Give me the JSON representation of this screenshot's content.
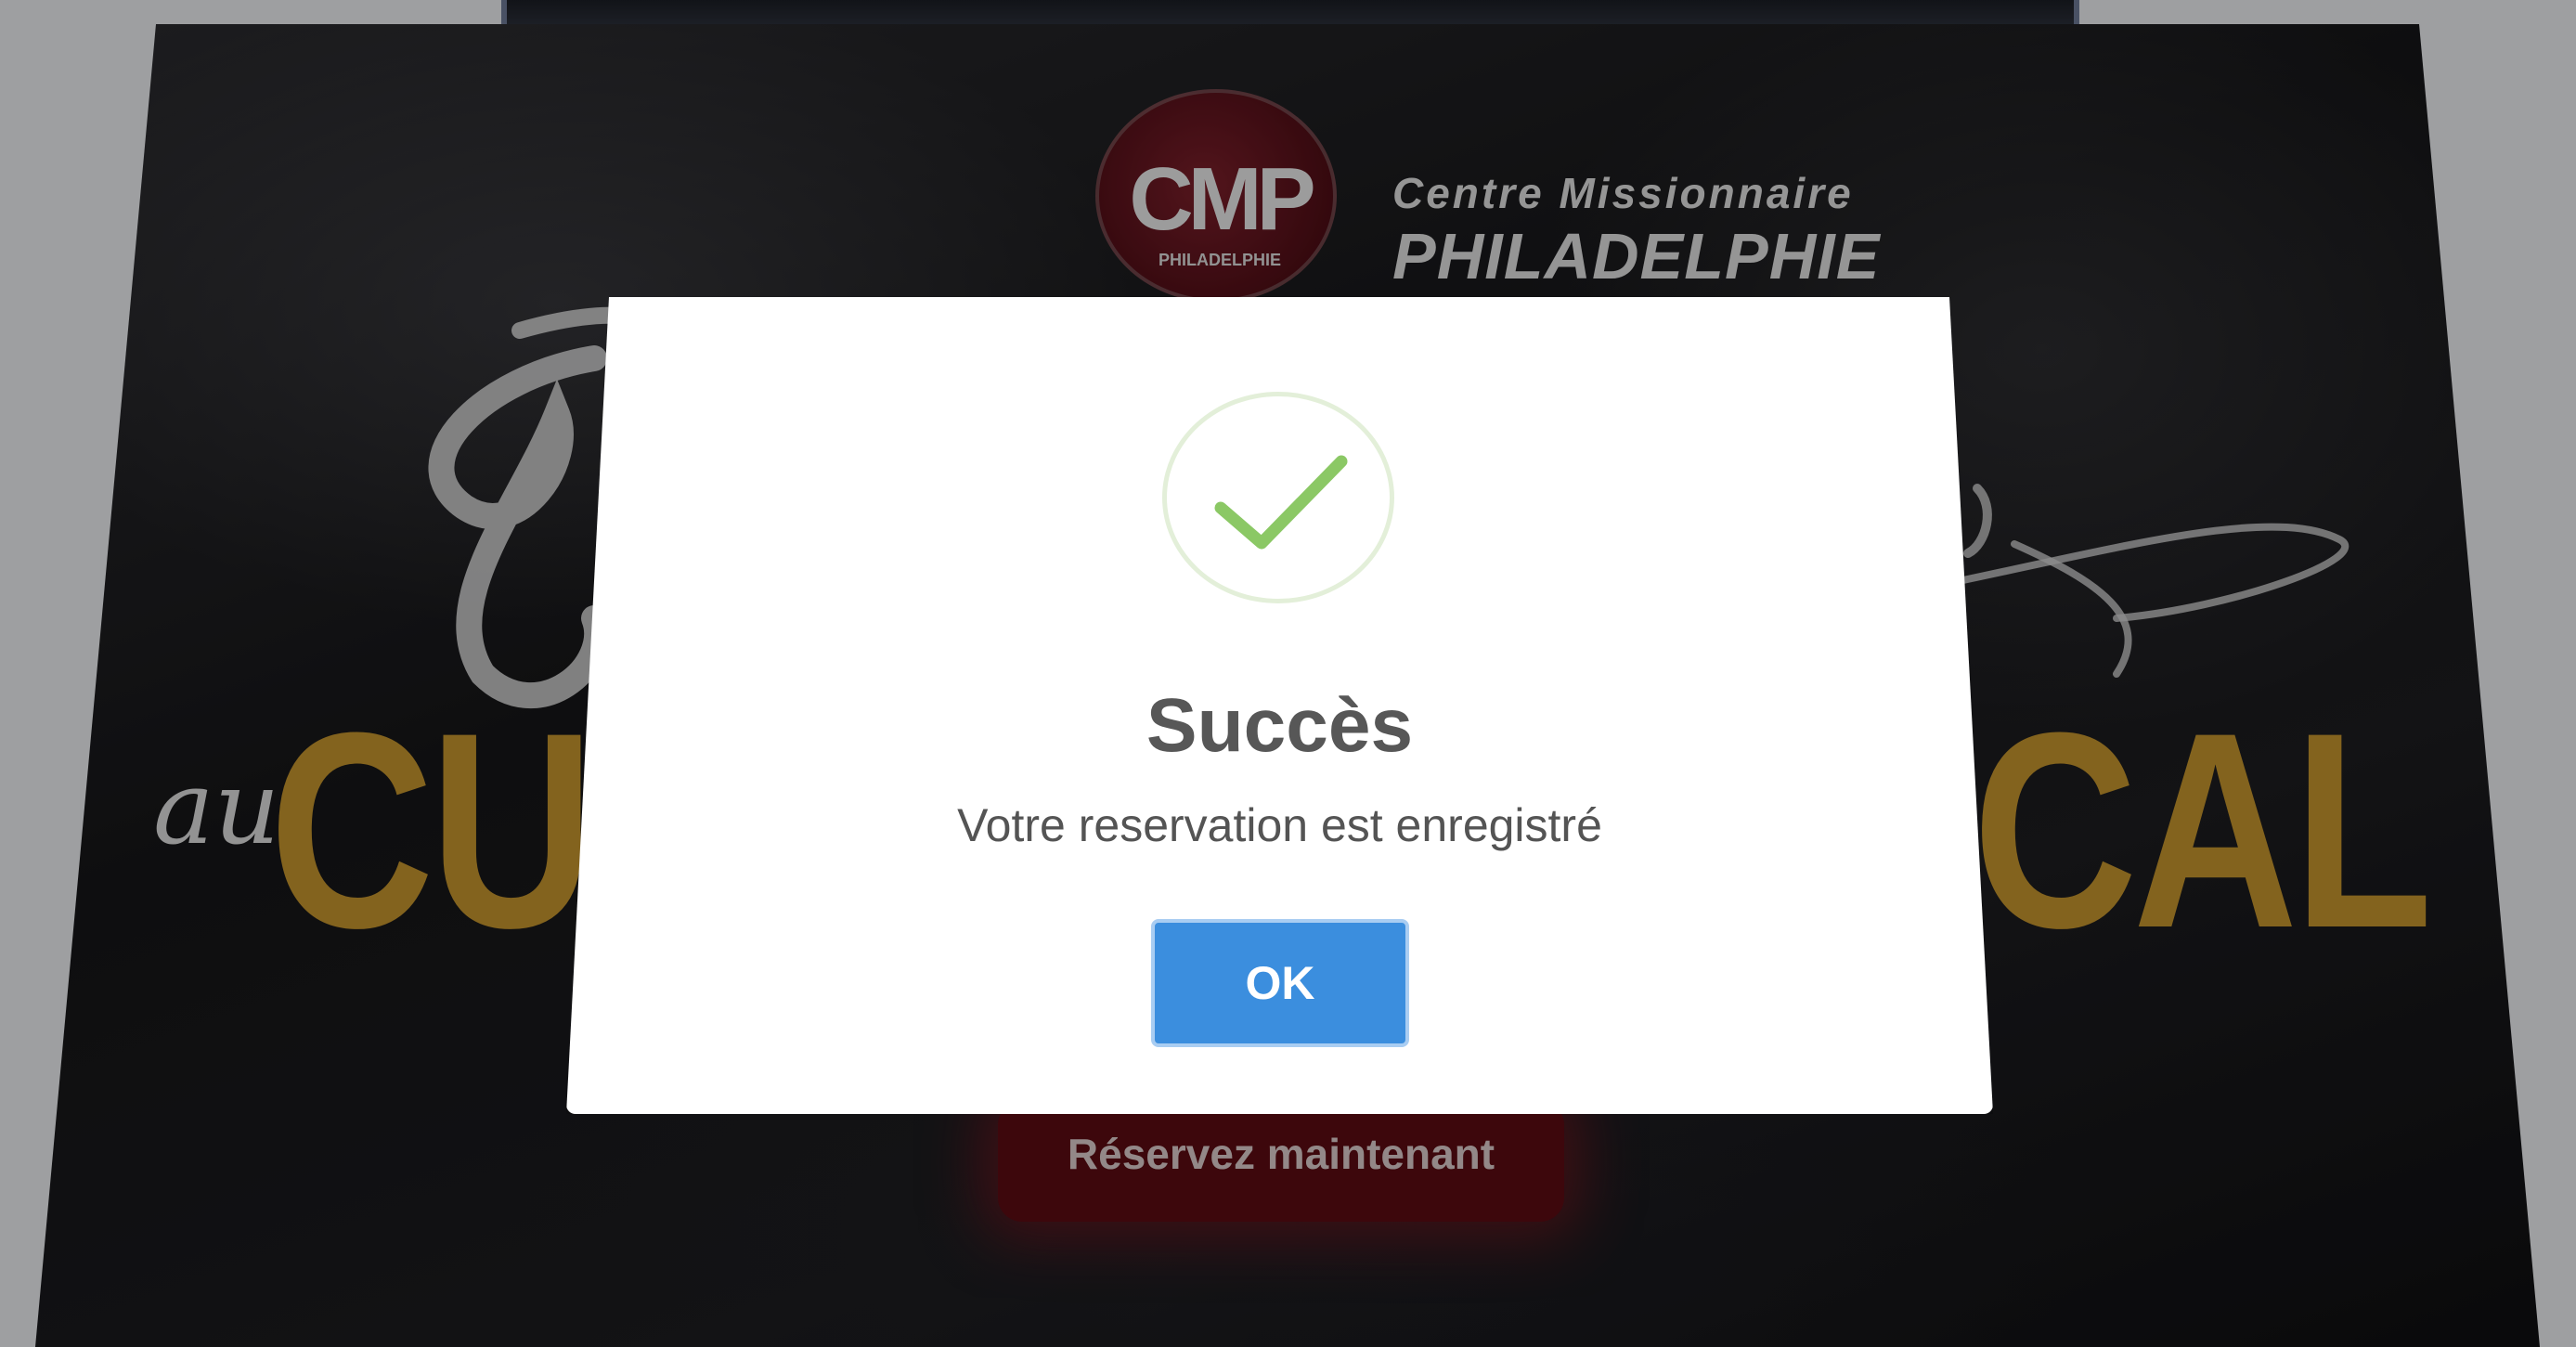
{
  "logo": {
    "seal_text": "CMP",
    "seal_subtext": "PHILADELPHIE",
    "line1": "Centre Missionnaire",
    "line2": "PHILADELPHIE"
  },
  "poster": {
    "script_prefix": "au",
    "word_left": "CU",
    "word_right": "CAL",
    "reserve_button_label": "Réservez maintenant"
  },
  "dialog": {
    "icon": "check-icon",
    "title": "Succès",
    "message": "Votre reservation est enregistré",
    "ok_label": "OK"
  },
  "colors": {
    "accent_gold": "#c2922d",
    "brand_red": "#5a0b12",
    "ok_blue": "#3b8ede",
    "success_green": "#8bc865"
  }
}
